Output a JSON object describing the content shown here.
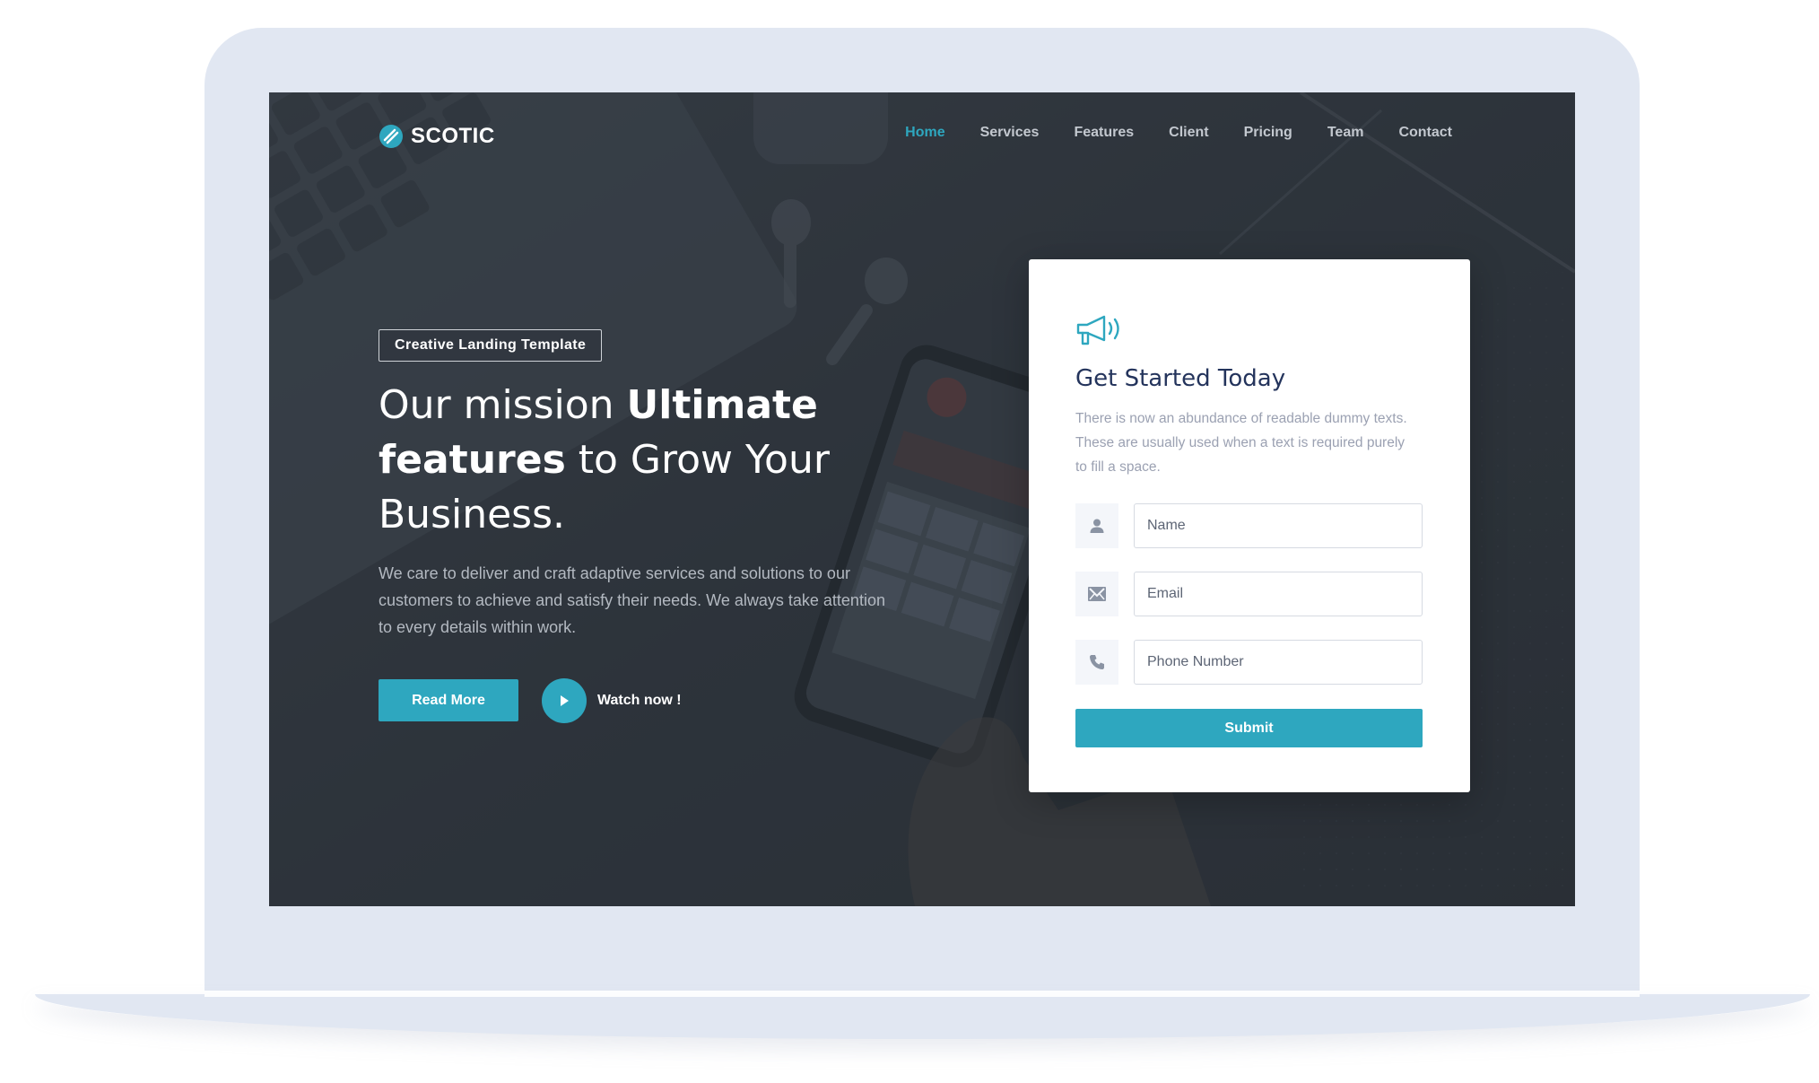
{
  "brand": {
    "name": "SCOTIC"
  },
  "nav": {
    "items": [
      {
        "label": "Home",
        "active": true
      },
      {
        "label": "Services",
        "active": false
      },
      {
        "label": "Features",
        "active": false
      },
      {
        "label": "Client",
        "active": false
      },
      {
        "label": "Pricing",
        "active": false
      },
      {
        "label": "Team",
        "active": false
      },
      {
        "label": "Contact",
        "active": false
      }
    ]
  },
  "hero": {
    "badge": "Creative Landing Template",
    "title_part1": "Our mission ",
    "title_bold1": "Ultimate features",
    "title_part2": " to Grow Your Business.",
    "description": "We care to deliver and craft adaptive services and solutions to our customers to achieve and satisfy their needs. We always take attention to every details within work.",
    "read_more_label": "Read More",
    "watch_label": "Watch now !"
  },
  "form": {
    "icon": "megaphone-icon",
    "title": "Get Started Today",
    "description": "There is now an abundance of readable dummy texts. These are usually used when a text is required purely to fill a space.",
    "fields": {
      "name_placeholder": "Name",
      "email_placeholder": "Email",
      "phone_placeholder": "Phone Number"
    },
    "submit_label": "Submit"
  },
  "colors": {
    "accent": "#2ea7bf",
    "heading": "#24345c",
    "background": "#2f353d",
    "frame": "#e1e7f2"
  }
}
